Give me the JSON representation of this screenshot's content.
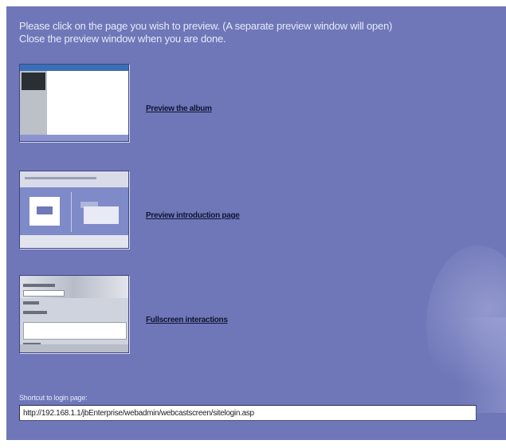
{
  "intro": {
    "line1": "Please click on the page you wish to preview. (A separate preview window will open)",
    "line2": "Close the preview window when you are done."
  },
  "previews": [
    {
      "label": "Preview the album",
      "thumbnail_icon": "album-page-thumbnail-icon"
    },
    {
      "label": "Preview introduction page",
      "thumbnail_icon": "introduction-page-thumbnail-icon"
    },
    {
      "label": "Fullscreen interactions",
      "thumbnail_icon": "interactions-page-thumbnail-icon"
    }
  ],
  "url": {
    "label": "Shortcut to login page:",
    "value": "http://192.168.1.1/jbEnterprise/webadmin/webcastscreen/sitelogin.asp"
  },
  "colors": {
    "background": "#6f77b9",
    "text": "#e7e9f7",
    "link": "#111633"
  }
}
